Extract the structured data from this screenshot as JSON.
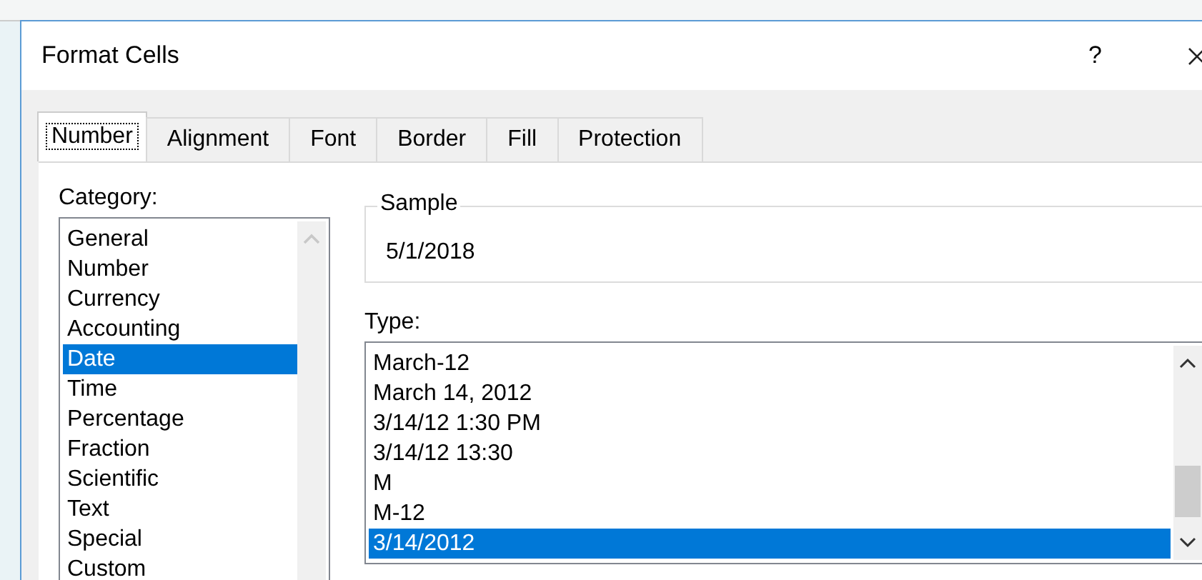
{
  "window": {
    "title": "Format Cells",
    "help": "?"
  },
  "tabs": [
    {
      "label": "Number",
      "selected": true
    },
    {
      "label": "Alignment",
      "selected": false
    },
    {
      "label": "Font",
      "selected": false
    },
    {
      "label": "Border",
      "selected": false
    },
    {
      "label": "Fill",
      "selected": false
    },
    {
      "label": "Protection",
      "selected": false
    }
  ],
  "category": {
    "label": "Category:",
    "items": [
      {
        "label": "General",
        "selected": false
      },
      {
        "label": "Number",
        "selected": false
      },
      {
        "label": "Currency",
        "selected": false
      },
      {
        "label": "Accounting",
        "selected": false
      },
      {
        "label": "Date",
        "selected": true
      },
      {
        "label": "Time",
        "selected": false
      },
      {
        "label": "Percentage",
        "selected": false
      },
      {
        "label": "Fraction",
        "selected": false
      },
      {
        "label": "Scientific",
        "selected": false
      },
      {
        "label": "Text",
        "selected": false
      },
      {
        "label": "Special",
        "selected": false
      },
      {
        "label": "Custom",
        "selected": false
      }
    ]
  },
  "sample": {
    "label": "Sample",
    "value": "5/1/2018"
  },
  "type": {
    "label": "Type:",
    "items": [
      {
        "label": "March-12",
        "selected": false
      },
      {
        "label": "March 14, 2012",
        "selected": false
      },
      {
        "label": "3/14/12 1:30 PM",
        "selected": false
      },
      {
        "label": "3/14/12 13:30",
        "selected": false
      },
      {
        "label": "M",
        "selected": false
      },
      {
        "label": "M-12",
        "selected": false
      },
      {
        "label": "3/14/2012",
        "selected": true
      }
    ]
  }
}
